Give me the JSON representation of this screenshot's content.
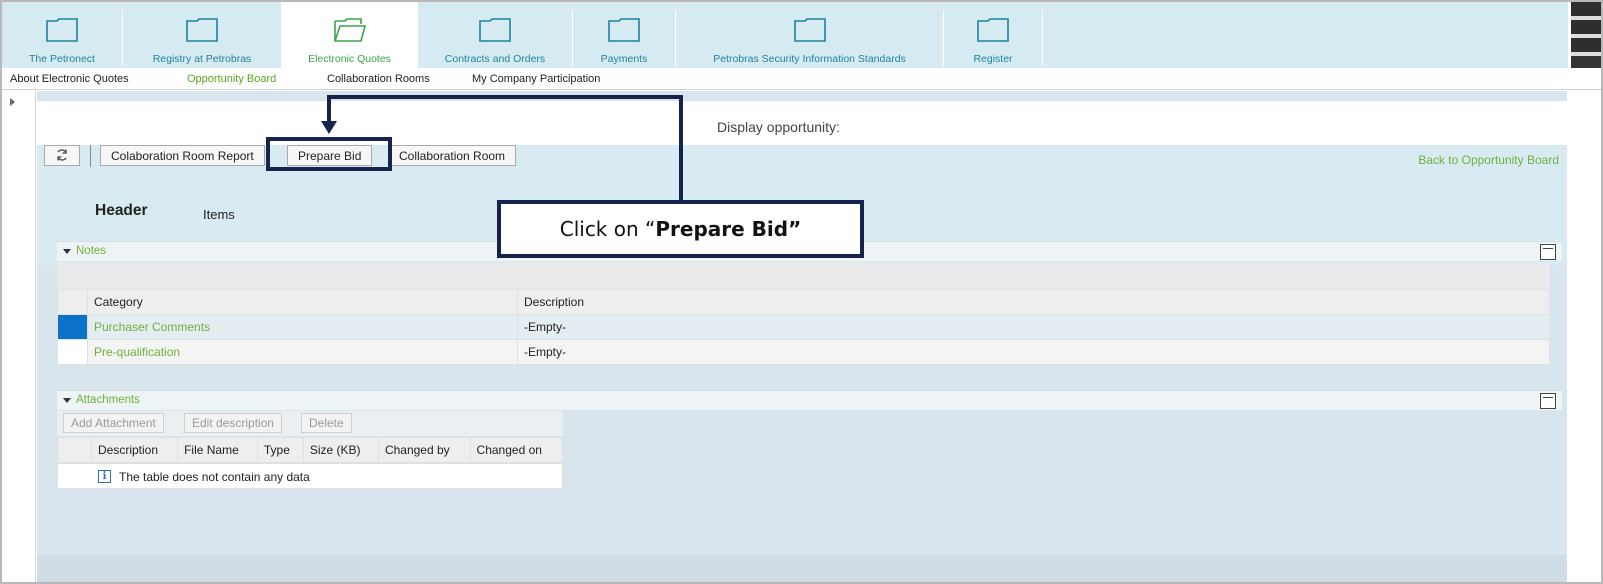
{
  "tabs": [
    {
      "label": "The Petronect",
      "icon": "folder-icon",
      "active": false
    },
    {
      "label": "Registry at Petrobras",
      "icon": "folder-icon",
      "active": false
    },
    {
      "label": "Electronic Quotes",
      "icon": "open-folder-icon",
      "active": true
    },
    {
      "label": "Contracts and Orders",
      "icon": "folder-icon",
      "active": false
    },
    {
      "label": "Payments",
      "icon": "folder-icon",
      "active": false
    },
    {
      "label": "Petrobras Security Information Standards",
      "icon": "folder-icon",
      "active": false
    },
    {
      "label": "Register",
      "icon": "folder-icon",
      "active": false
    }
  ],
  "subnav": [
    {
      "label": "About Electronic Quotes",
      "active": false
    },
    {
      "label": "Opportunity Board",
      "active": true
    },
    {
      "label": "Collaboration Rooms",
      "active": false
    },
    {
      "label": "My Company Participation",
      "active": false
    }
  ],
  "page": {
    "title": "Display opportunity:"
  },
  "toolbar": {
    "refresh_icon": "refresh-icon",
    "collab_report": "Colaboration Room Report",
    "prepare_bid": "Prepare Bid",
    "collab_room": "Collaboration Room",
    "back_link": "Back to Opportunity Board"
  },
  "subtabs": {
    "header": "Header",
    "items": "Items"
  },
  "notes": {
    "title": "Notes",
    "columns": [
      "Category",
      "Description"
    ],
    "rows": [
      {
        "category": "Purchaser Comments",
        "description": "-Empty-",
        "selected": true
      },
      {
        "category": "Pre-qualification",
        "description": "-Empty-",
        "selected": false
      }
    ]
  },
  "attachments": {
    "title": "Attachments",
    "buttons": {
      "add": "Add Attachment",
      "edit": "Edit description",
      "delete": "Delete"
    },
    "columns": [
      "Description",
      "File Name",
      "Type",
      "Size (KB)",
      "Changed by",
      "Changed on"
    ],
    "empty_message": "The table does not contain any data",
    "info_icon": "i"
  },
  "annotation": {
    "callout_prefix": "Click on “",
    "callout_bold": "Prepare Bid”",
    "color": "#16244d"
  },
  "colors": {
    "tab_bar": "#d6ebf1",
    "link_green": "#6fb13c",
    "tab_blue": "#1f82a3",
    "selection": "#0a73c8"
  }
}
